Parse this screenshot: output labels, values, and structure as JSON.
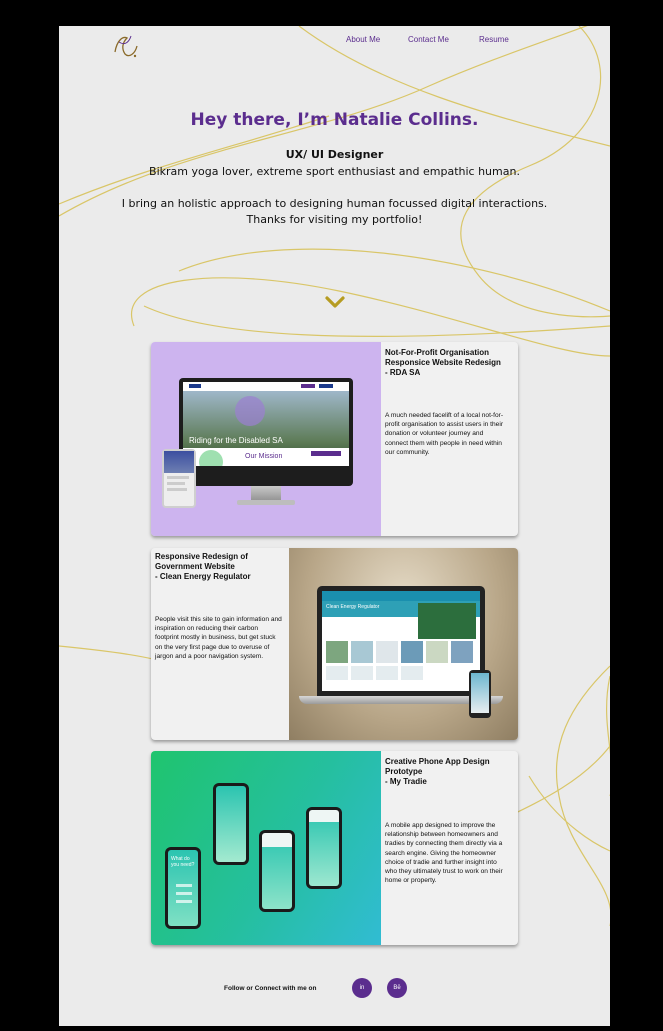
{
  "header": {
    "logo_text": "NC",
    "nav": [
      {
        "label": "About Me"
      },
      {
        "label": "Contact Me"
      },
      {
        "label": "Resume"
      }
    ]
  },
  "hero": {
    "title": "Hey there, I’m Natalie Collins.",
    "role": "UX/ UI Designer",
    "tagline": "Bikram yoga lover, extreme sport enthusiast and empathic human.",
    "approach": "I bring an holistic approach to designing human focussed digital interactions.",
    "thanks": "Thanks for visiting my portfolio!"
  },
  "projects": [
    {
      "title": "Not-For-Profit Organisation\nResponsice Website Redesign\n- RDA SA",
      "description": "A much needed facelift of a local not-for-profit organisation to assist users in their donation or volunteer journey and connect them with people in need within our community.",
      "mock_headline": "Riding for the Disabled SA",
      "mock_subhead": "Our Mission"
    },
    {
      "title": "Responsive Redesign of\nGovernment Website\n- Clean Energy Regulator",
      "description": "People visit this site to gain information and inspiration on reducing their carbon footprint mostly in business, but get stuck on the very first page due to overuse of jargon and a poor navigation system.",
      "mock_headline": "Clean Energy Regulator"
    },
    {
      "title": "Creative Phone App Design\nPrototype\n- My Tradie",
      "description": "A mobile app designed to improve the relationship between homeowners and tradies by connecting them directly via a search engine. Giving the homeowner choice of tradie and further insight into who they ultimately trust to work on their home or property.",
      "mock_question": "What do you need?"
    }
  ],
  "footer": {
    "follow_text": "Follow or Connect with me on",
    "socials": [
      {
        "label": "in",
        "icon": "linkedin-icon"
      },
      {
        "label": "Bē",
        "icon": "behance-icon"
      }
    ]
  },
  "colors": {
    "accent": "#5b2d8e",
    "swirl": "#d8c25a",
    "card1_bg": "#cdb4ef",
    "card3_gradient_start": "#1fc46e",
    "card3_gradient_end": "#31bcd3"
  }
}
